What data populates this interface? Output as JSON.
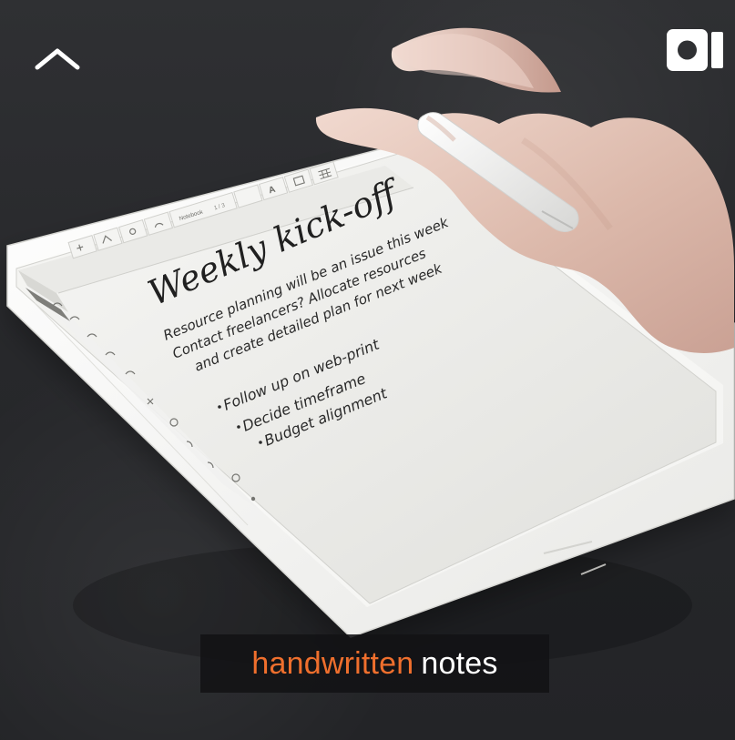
{
  "ui": {
    "top_left_icon": "chevron-up-icon",
    "top_right_icon": "video-camera-icon"
  },
  "device": {
    "toolbar_label": "Notebook",
    "toolbar_page": "1 / 3",
    "heading": "Weekly kick-off",
    "paragraph_lines": [
      "Resource planning will be an issue this week",
      "Contact freelancers? Allocate resources",
      "and create detailed plan for next week"
    ],
    "bullets": [
      "Follow up on web-print",
      "Decide timeframe",
      "Budget alignment"
    ]
  },
  "caption": {
    "accent": "handwritten",
    "rest": "notes"
  },
  "colors": {
    "caption_accent": "#ef6f2d",
    "caption_text": "#ffffff",
    "caption_bg": "#121214"
  }
}
